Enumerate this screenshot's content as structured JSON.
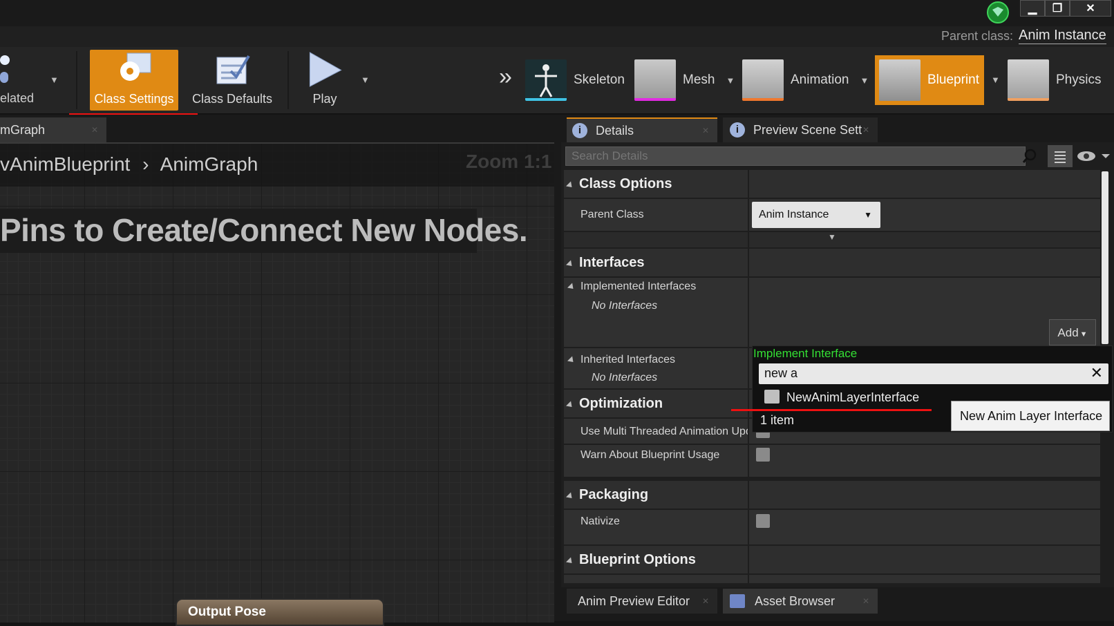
{
  "window": {
    "parent_class_label": "Parent class:",
    "parent_class_value": "Anim Instance",
    "minimize": "▁",
    "restore": "❐",
    "close": "✕"
  },
  "toolbar": {
    "related_label": "elated",
    "class_settings": "Class Settings",
    "class_defaults": "Class Defaults",
    "play": "Play",
    "overflow": "»",
    "modes": {
      "skeleton": "Skeleton",
      "mesh": "Mesh",
      "animation": "Animation",
      "blueprint": "Blueprint",
      "physics": "Physics"
    },
    "dropdown_arrow": "▼"
  },
  "graph": {
    "tab_label": "mGraph",
    "breadcrumb_root": "vAnimBlueprint",
    "breadcrumb_sep": "›",
    "breadcrumb_leaf": "AnimGraph",
    "zoom": "Zoom 1:1",
    "hint": "Pins to Create/Connect New Nodes.",
    "output_pose": "Output Pose"
  },
  "details_tabs": {
    "details": "Details",
    "preview_scene": "Preview Scene Sett"
  },
  "search": {
    "placeholder": "Search Details"
  },
  "categories": {
    "class_options": "Class Options",
    "interfaces": "Interfaces",
    "optimization": "Optimization",
    "packaging": "Packaging",
    "blueprint_options": "Blueprint Options"
  },
  "props": {
    "parent_class": "Parent Class",
    "parent_class_value": "Anim Instance",
    "implemented_interfaces": "Implemented Interfaces",
    "no_interfaces_1": "No Interfaces",
    "add": "Add",
    "inherited_interfaces": "Inherited Interfaces",
    "no_interfaces_2": "No Interfaces",
    "use_multi_threaded": "Use Multi Threaded Animation Upd",
    "warn_blueprint_usage": "Warn About Blueprint Usage",
    "nativize": "Nativize"
  },
  "popup": {
    "title": "Implement Interface",
    "search_value": "new a",
    "result": "NewAnimLayerInterface",
    "count": "1 item",
    "tooltip": "New Anim Layer Interface"
  },
  "bottom_tabs": {
    "anim_preview": "Anim Preview Editor",
    "asset_browser": "Asset Browser"
  },
  "colors": {
    "accent_orange": "#e08a14",
    "popup_title_green": "#34e034",
    "underline_red": "#e11111"
  }
}
